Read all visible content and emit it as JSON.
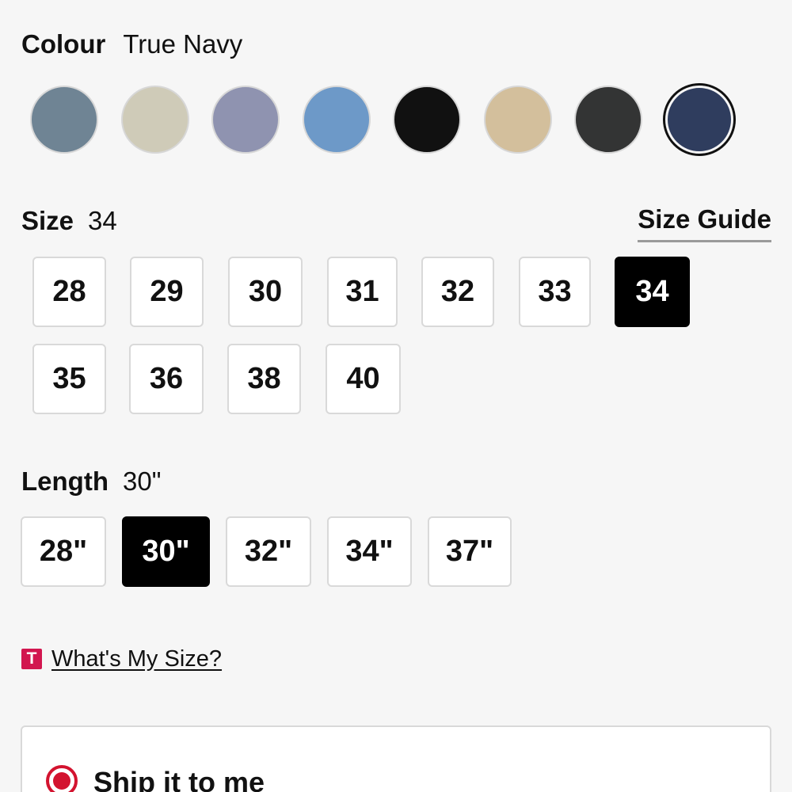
{
  "colour": {
    "label": "Colour",
    "selected_value": "True Navy",
    "swatches": [
      {
        "name": "swatch-slate-blue",
        "color": "#6f8494"
      },
      {
        "name": "swatch-light-khaki",
        "color": "#cfcbb8"
      },
      {
        "name": "swatch-lavender-grey",
        "color": "#8f93b0"
      },
      {
        "name": "swatch-sky-blue",
        "color": "#6d99c8"
      },
      {
        "name": "swatch-black",
        "color": "#111111"
      },
      {
        "name": "swatch-tan",
        "color": "#d3bf9c"
      },
      {
        "name": "swatch-charcoal",
        "color": "#333434"
      },
      {
        "name": "swatch-true-navy",
        "color": "#2f3d5e",
        "selected": true
      }
    ]
  },
  "size": {
    "label": "Size",
    "selected_value": "34",
    "guide_label": "Size Guide",
    "options": [
      "28",
      "29",
      "30",
      "31",
      "32",
      "33",
      "34",
      "35",
      "36",
      "38",
      "40"
    ],
    "selected": "34"
  },
  "length": {
    "label": "Length",
    "selected_value": "30\"",
    "options": [
      "28\"",
      "30\"",
      "32\"",
      "34\"",
      "37\""
    ],
    "selected": "30\""
  },
  "whats_my_size": {
    "logo_letter": "T",
    "link_label": "What's My Size?"
  },
  "shipping": {
    "option_label": "Ship it to me",
    "selected": true
  },
  "colors": {
    "accent_red": "#d3132f",
    "logo_pink": "#d2164f"
  }
}
